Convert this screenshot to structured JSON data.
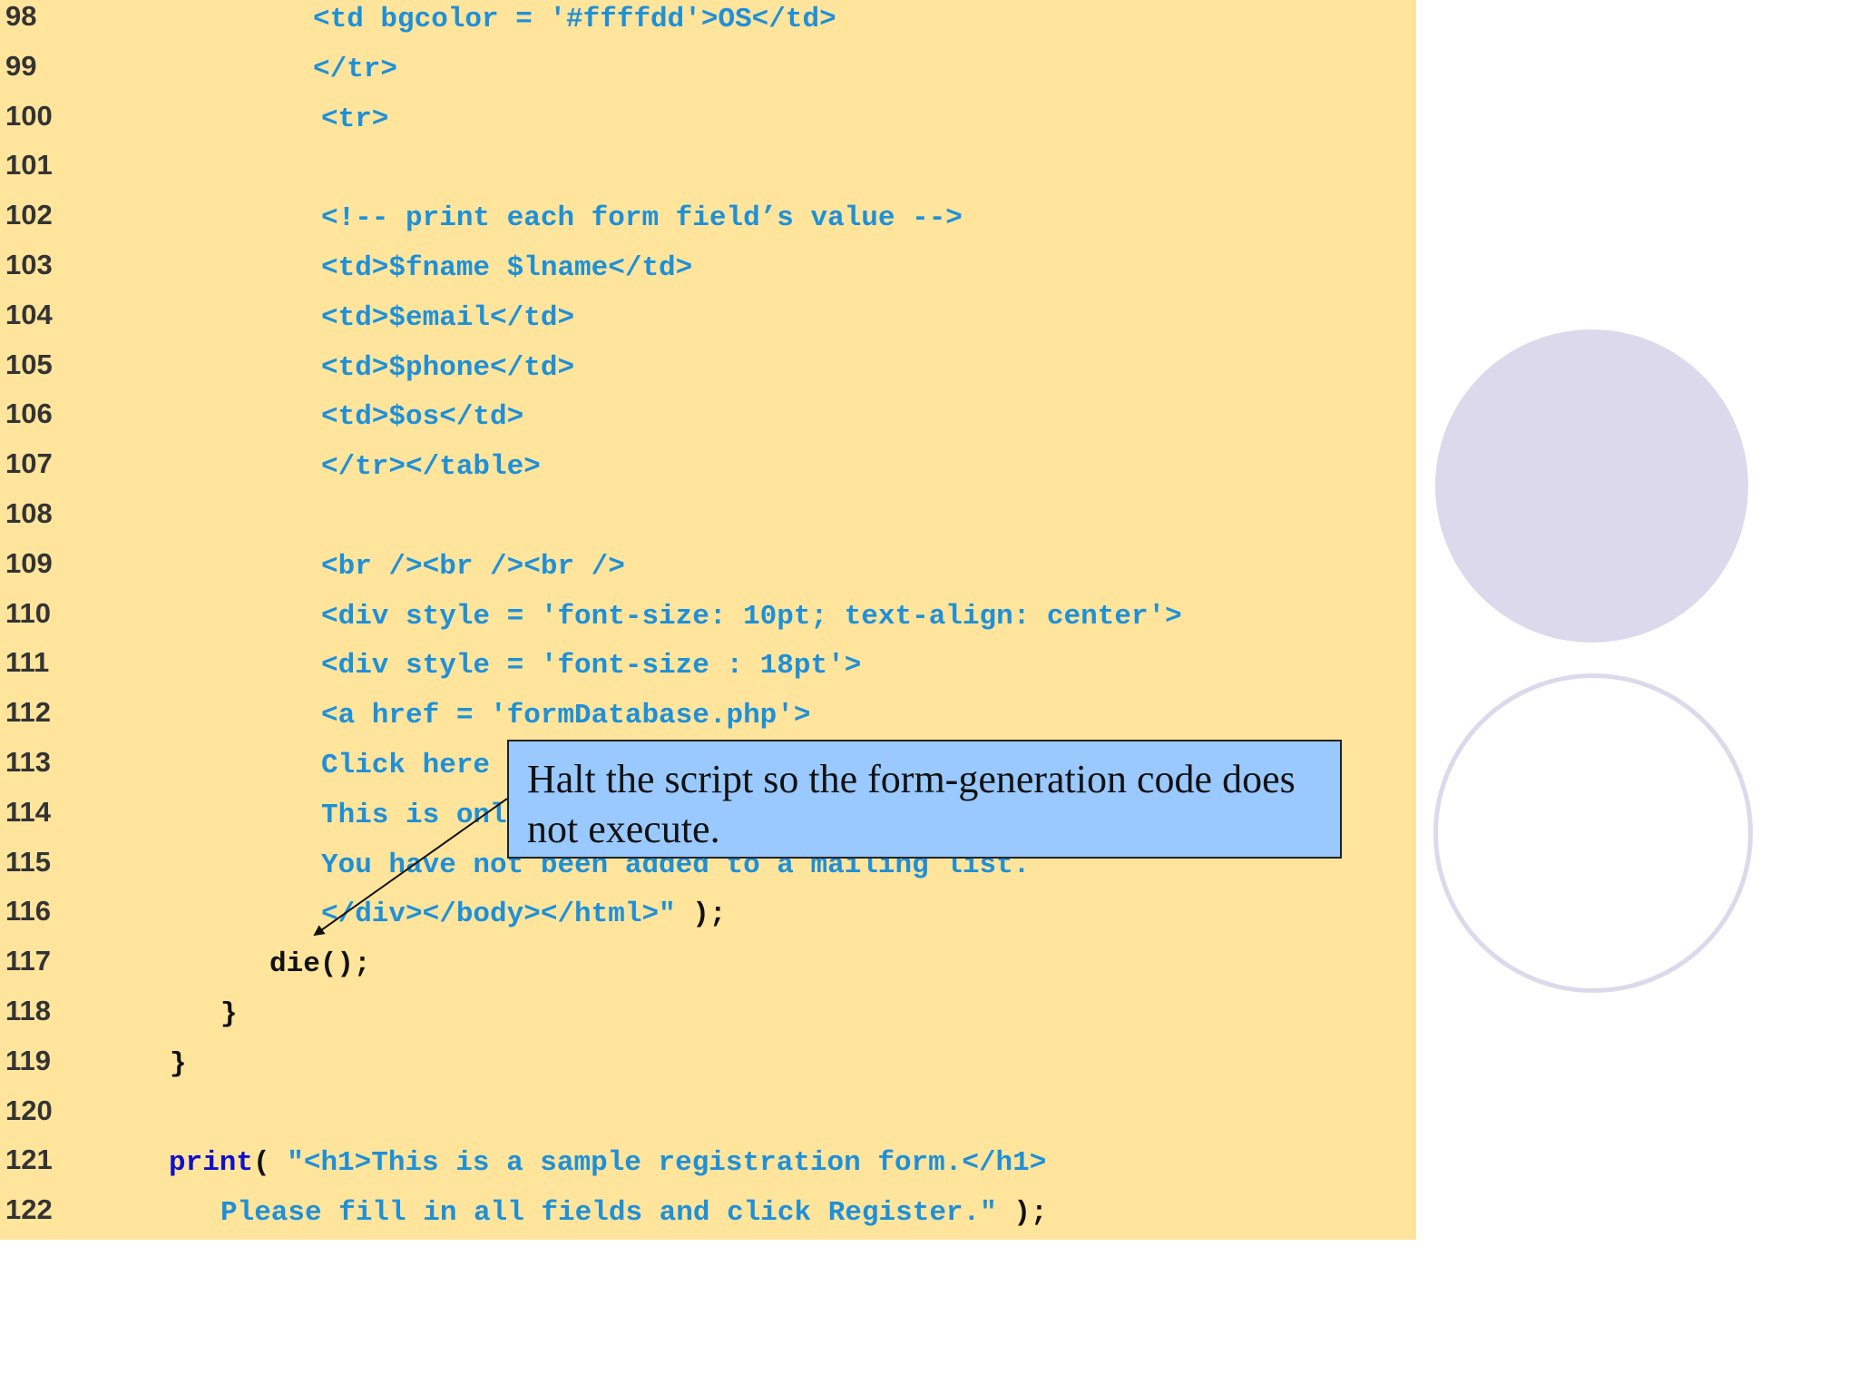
{
  "code_lines": [
    {
      "num": "98",
      "parts": [
        {
          "t": "<td bgcolor = '#ffffdd'>OS</td>",
          "c": "str"
        }
      ],
      "indent": 345
    },
    {
      "num": "99",
      "parts": [
        {
          "t": "</tr>",
          "c": "str"
        }
      ],
      "indent": 345
    },
    {
      "num": "100",
      "parts": [
        {
          "t": "<tr>",
          "c": "str"
        }
      ],
      "indent": 354
    },
    {
      "num": "101",
      "parts": [],
      "indent": 354
    },
    {
      "num": "102",
      "parts": [
        {
          "t": "<!-- print each form field’s value -->",
          "c": "str"
        }
      ],
      "indent": 354
    },
    {
      "num": "103",
      "parts": [
        {
          "t": "<td>$fname $lname</td>",
          "c": "str"
        }
      ],
      "indent": 354
    },
    {
      "num": "104",
      "parts": [
        {
          "t": "<td>$email</td>",
          "c": "str"
        }
      ],
      "indent": 354
    },
    {
      "num": "105",
      "parts": [
        {
          "t": "<td>$phone</td>",
          "c": "str"
        }
      ],
      "indent": 354
    },
    {
      "num": "106",
      "parts": [
        {
          "t": "<td>$os</td>",
          "c": "str"
        }
      ],
      "indent": 354
    },
    {
      "num": "107",
      "parts": [
        {
          "t": "</tr></table>",
          "c": "str"
        }
      ],
      "indent": 354
    },
    {
      "num": "108",
      "parts": [],
      "indent": 354
    },
    {
      "num": "109",
      "parts": [
        {
          "t": "<br /><br /><br />",
          "c": "str"
        }
      ],
      "indent": 354
    },
    {
      "num": "110",
      "parts": [
        {
          "t": "<div style = 'font-size: 10pt; text-align: center'>",
          "c": "str"
        }
      ],
      "indent": 354
    },
    {
      "num": "111",
      "parts": [
        {
          "t": "<div style = 'font-size : 18pt'>",
          "c": "str"
        }
      ],
      "indent": 354
    },
    {
      "num": "112",
      "parts": [
        {
          "t": "<a href = 'formDatabase.php'>",
          "c": "str"
        }
      ],
      "indent": 354
    },
    {
      "num": "113",
      "parts": [
        {
          "t": "Click here",
          "c": "str"
        }
      ],
      "indent": 354
    },
    {
      "num": "114",
      "parts": [
        {
          "t": "This is onl",
          "c": "str"
        }
      ],
      "indent": 354
    },
    {
      "num": "115",
      "parts": [
        {
          "t": "You have not been added to a mailing list.",
          "c": "str"
        }
      ],
      "indent": 354
    },
    {
      "num": "116",
      "parts": [
        {
          "t": "</div></body></html>\"",
          "c": "str"
        },
        {
          "t": " );",
          "c": "plain"
        }
      ],
      "indent": 354
    },
    {
      "num": "117",
      "parts": [
        {
          "t": "die();",
          "c": "plain"
        }
      ],
      "indent": 297
    },
    {
      "num": "118",
      "parts": [
        {
          "t": "}",
          "c": "plain"
        }
      ],
      "indent": 243
    },
    {
      "num": "119",
      "parts": [
        {
          "t": "}",
          "c": "plain"
        }
      ],
      "indent": 187
    },
    {
      "num": "120",
      "parts": [],
      "indent": 187
    },
    {
      "num": "121",
      "parts": [
        {
          "t": "print",
          "c": "kw"
        },
        {
          "t": "( ",
          "c": "plain"
        },
        {
          "t": "\"<h1>This is a sample registration form.</h1>",
          "c": "str"
        }
      ],
      "indent": 186
    },
    {
      "num": "122",
      "parts": [
        {
          "t": "Please fill in all fields and click Register.\"",
          "c": "str"
        },
        {
          "t": " );",
          "c": "plain"
        }
      ],
      "indent": 243
    }
  ],
  "callout": {
    "text": "Halt the script so the form-generation code does not execute."
  },
  "colors": {
    "panel_bg": "#ffe49c",
    "string": "#1e90d8",
    "keyword": "#1010cc",
    "callout_bg": "#99c9ff",
    "circle": "#dcd9ec"
  }
}
